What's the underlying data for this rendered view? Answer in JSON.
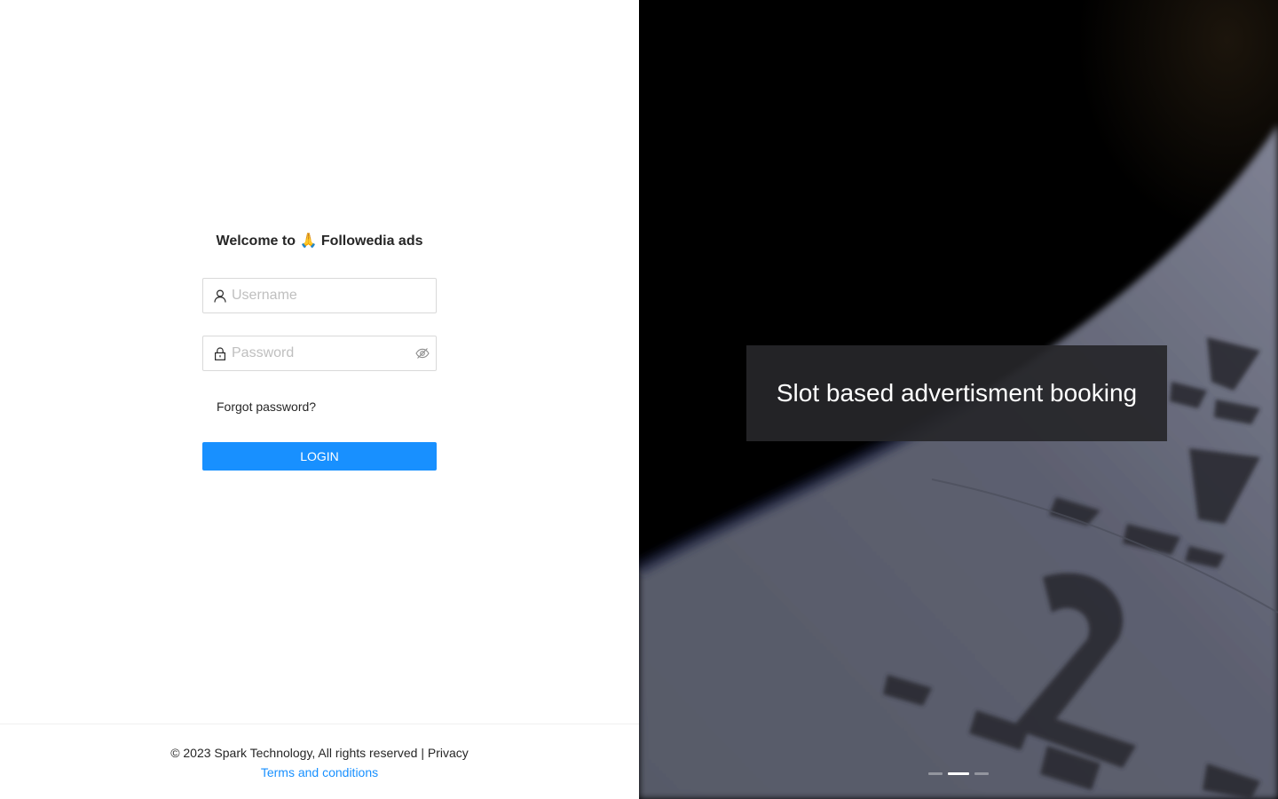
{
  "login": {
    "welcome": "Welcome to 🙏 Followedia ads",
    "username_placeholder": "Username",
    "password_placeholder": "Password",
    "forgot_label": "Forgot password?",
    "login_label": "LOGIN"
  },
  "footer": {
    "copyright": "© 2023 Spark Technology, All rights reserved |",
    "privacy_label": "Privacy",
    "terms_label": "Terms and conditions"
  },
  "carousel": {
    "caption": "Slot based advertisment booking",
    "slide_count": 3,
    "active_slide": 2
  },
  "colors": {
    "primary": "#1890ff",
    "caption_bg": "#262629"
  }
}
